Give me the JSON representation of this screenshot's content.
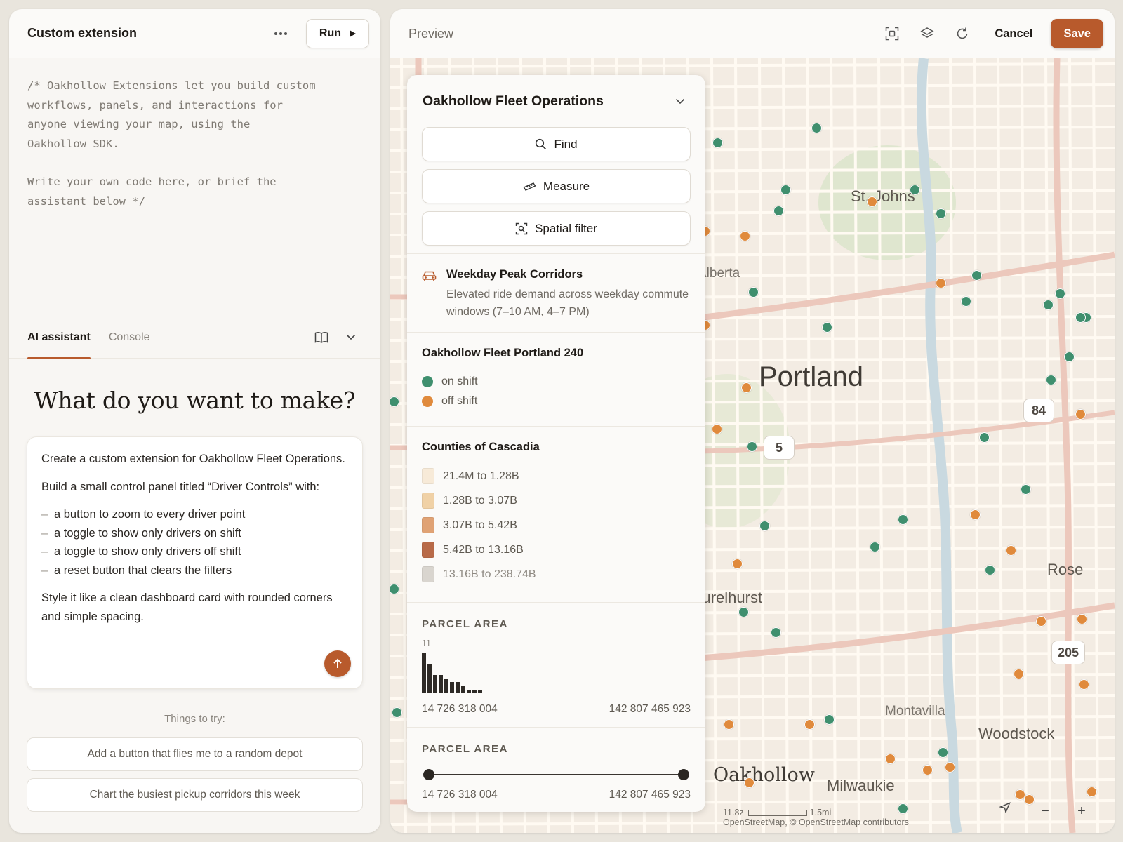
{
  "editor": {
    "title": "Custom extension",
    "run_label": "Run",
    "code_lines_1": [
      "/* Oakhollow Extensions let you build custom",
      "workflows, panels, and interactions for",
      "anyone viewing your map, using the",
      "Oakhollow SDK."
    ],
    "code_lines_2": [
      "Write your own code here, or brief the",
      "assistant below */"
    ]
  },
  "tabs": {
    "assistant": "AI assistant",
    "console": "Console"
  },
  "assistant": {
    "heading": "What do you want to make?",
    "prompt": {
      "p1": "Create a custom extension for Oakhollow Fleet Operations.",
      "p2": "Build a small control panel titled “Driver Controls” with:",
      "items": [
        "a button to zoom to every driver point",
        "a toggle to show only drivers on shift",
        "a toggle to show only drivers off shift",
        "a reset button that clears the filters"
      ],
      "p3": "Style it like a clean dashboard card with rounded corners and simple spacing."
    },
    "things_to_try": "Things to try:",
    "suggestions": [
      "Add a button that flies me to a random depot",
      "Chart the busiest pickup corridors this week"
    ]
  },
  "preview": {
    "title": "Preview",
    "cancel_label": "Cancel",
    "save_label": "Save"
  },
  "panel": {
    "title": "Oakhollow Fleet Operations",
    "buttons": [
      "Find",
      "Measure",
      "Spatial filter"
    ],
    "corridor": {
      "title": "Weekday Peak Corridors",
      "desc": "Elevated ride demand across weekday commute windows (7–10 AM, 4–7 PM)"
    },
    "fleet": {
      "title": "Oakhollow Fleet Portland 240",
      "legend": [
        {
          "label": "on shift",
          "color": "#3f8f6e"
        },
        {
          "label": "off shift",
          "color": "#e08a3c"
        }
      ]
    },
    "counties": {
      "title": "Counties of Cascadia",
      "classes": [
        {
          "label": "21.4M to 1.28B",
          "color": "#f7ead8"
        },
        {
          "label": "1.28B to 3.07B",
          "color": "#f0d1a6"
        },
        {
          "label": "3.07B to 5.42B",
          "color": "#e0a274"
        },
        {
          "label": "5.42B to 13.16B",
          "color": "#b86a48"
        },
        {
          "label": "13.16B to 238.74B",
          "color": "#d9d5cf"
        }
      ]
    },
    "parcel_hist": {
      "title": "PARCEL AREA",
      "max_count": "11",
      "counts": [
        11,
        8,
        5,
        5,
        4,
        3,
        3,
        2,
        1,
        1,
        1
      ],
      "min_label": "14 726 318 004",
      "max_label": "142 807 465 923"
    },
    "parcel_slider": {
      "title": "PARCEL AREA",
      "min_label": "14 726 318 004",
      "max_label": "142 807 465 923"
    }
  },
  "map": {
    "labels": {
      "st_johns": "St. Johns",
      "alberta": "Alberta",
      "portland": "Portland",
      "rose": "Rose",
      "laurelhurst": "Laurelhurst",
      "montavilla": "Montavilla",
      "woodstock": "Woodstock",
      "oakhollow": "Oakhollow",
      "milwaukie": "Milwaukie"
    },
    "highways": {
      "h84": "84",
      "h5": "5",
      "h205": "205"
    },
    "zoom_text": "11.8z",
    "scale_text": "1.5mi",
    "attribution": "OpenStreetMap, © OpenStreetMap contributors",
    "colors": {
      "on_shift": "#3f8f6e",
      "off_shift": "#e08a3c"
    }
  }
}
